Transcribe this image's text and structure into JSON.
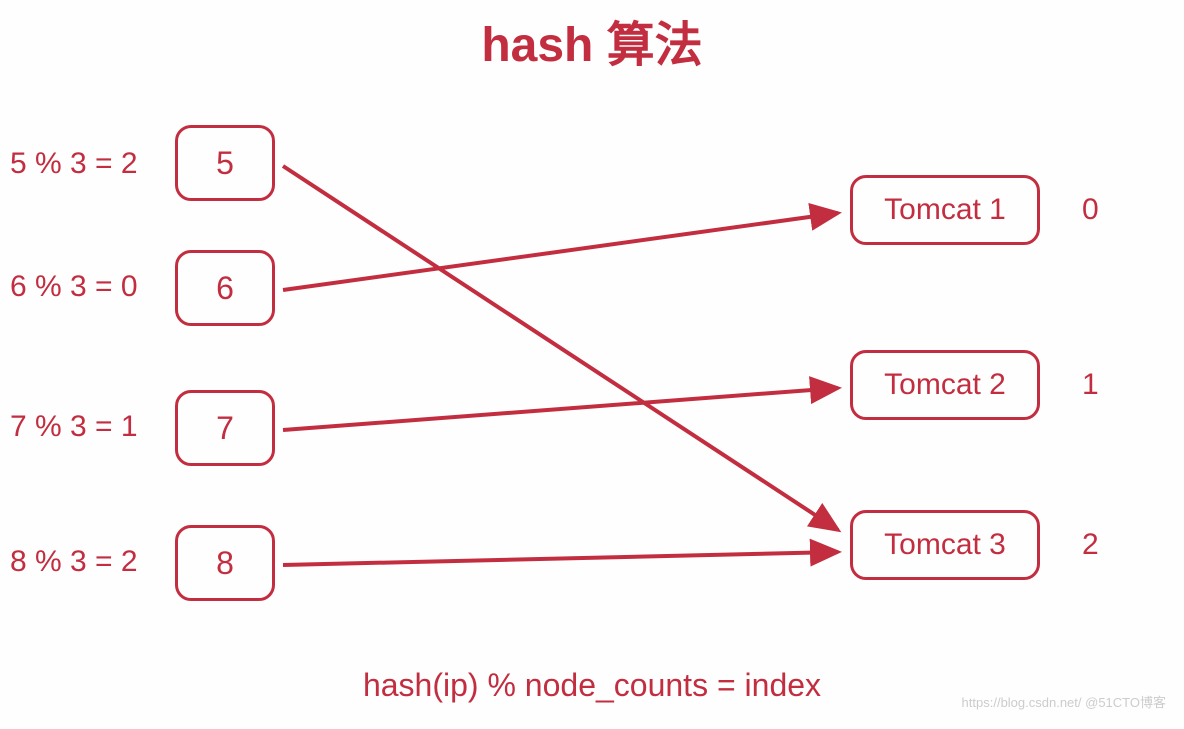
{
  "title": "hash 算法",
  "formula": "hash(ip) % node_counts = index",
  "watermark": "https://blog.csdn.net/   @51CTO博客",
  "left": {
    "eq1": "5 % 3 = 2",
    "eq2": "6 % 3 = 0",
    "eq3": "7 % 3 = 1",
    "eq4": "8 % 3 = 2",
    "box1": "5",
    "box2": "6",
    "box3": "7",
    "box4": "8"
  },
  "right": {
    "tomcat1": "Tomcat 1",
    "tomcat2": "Tomcat 2",
    "tomcat3": "Tomcat 3",
    "idx1": "0",
    "idx2": "1",
    "idx3": "2"
  }
}
